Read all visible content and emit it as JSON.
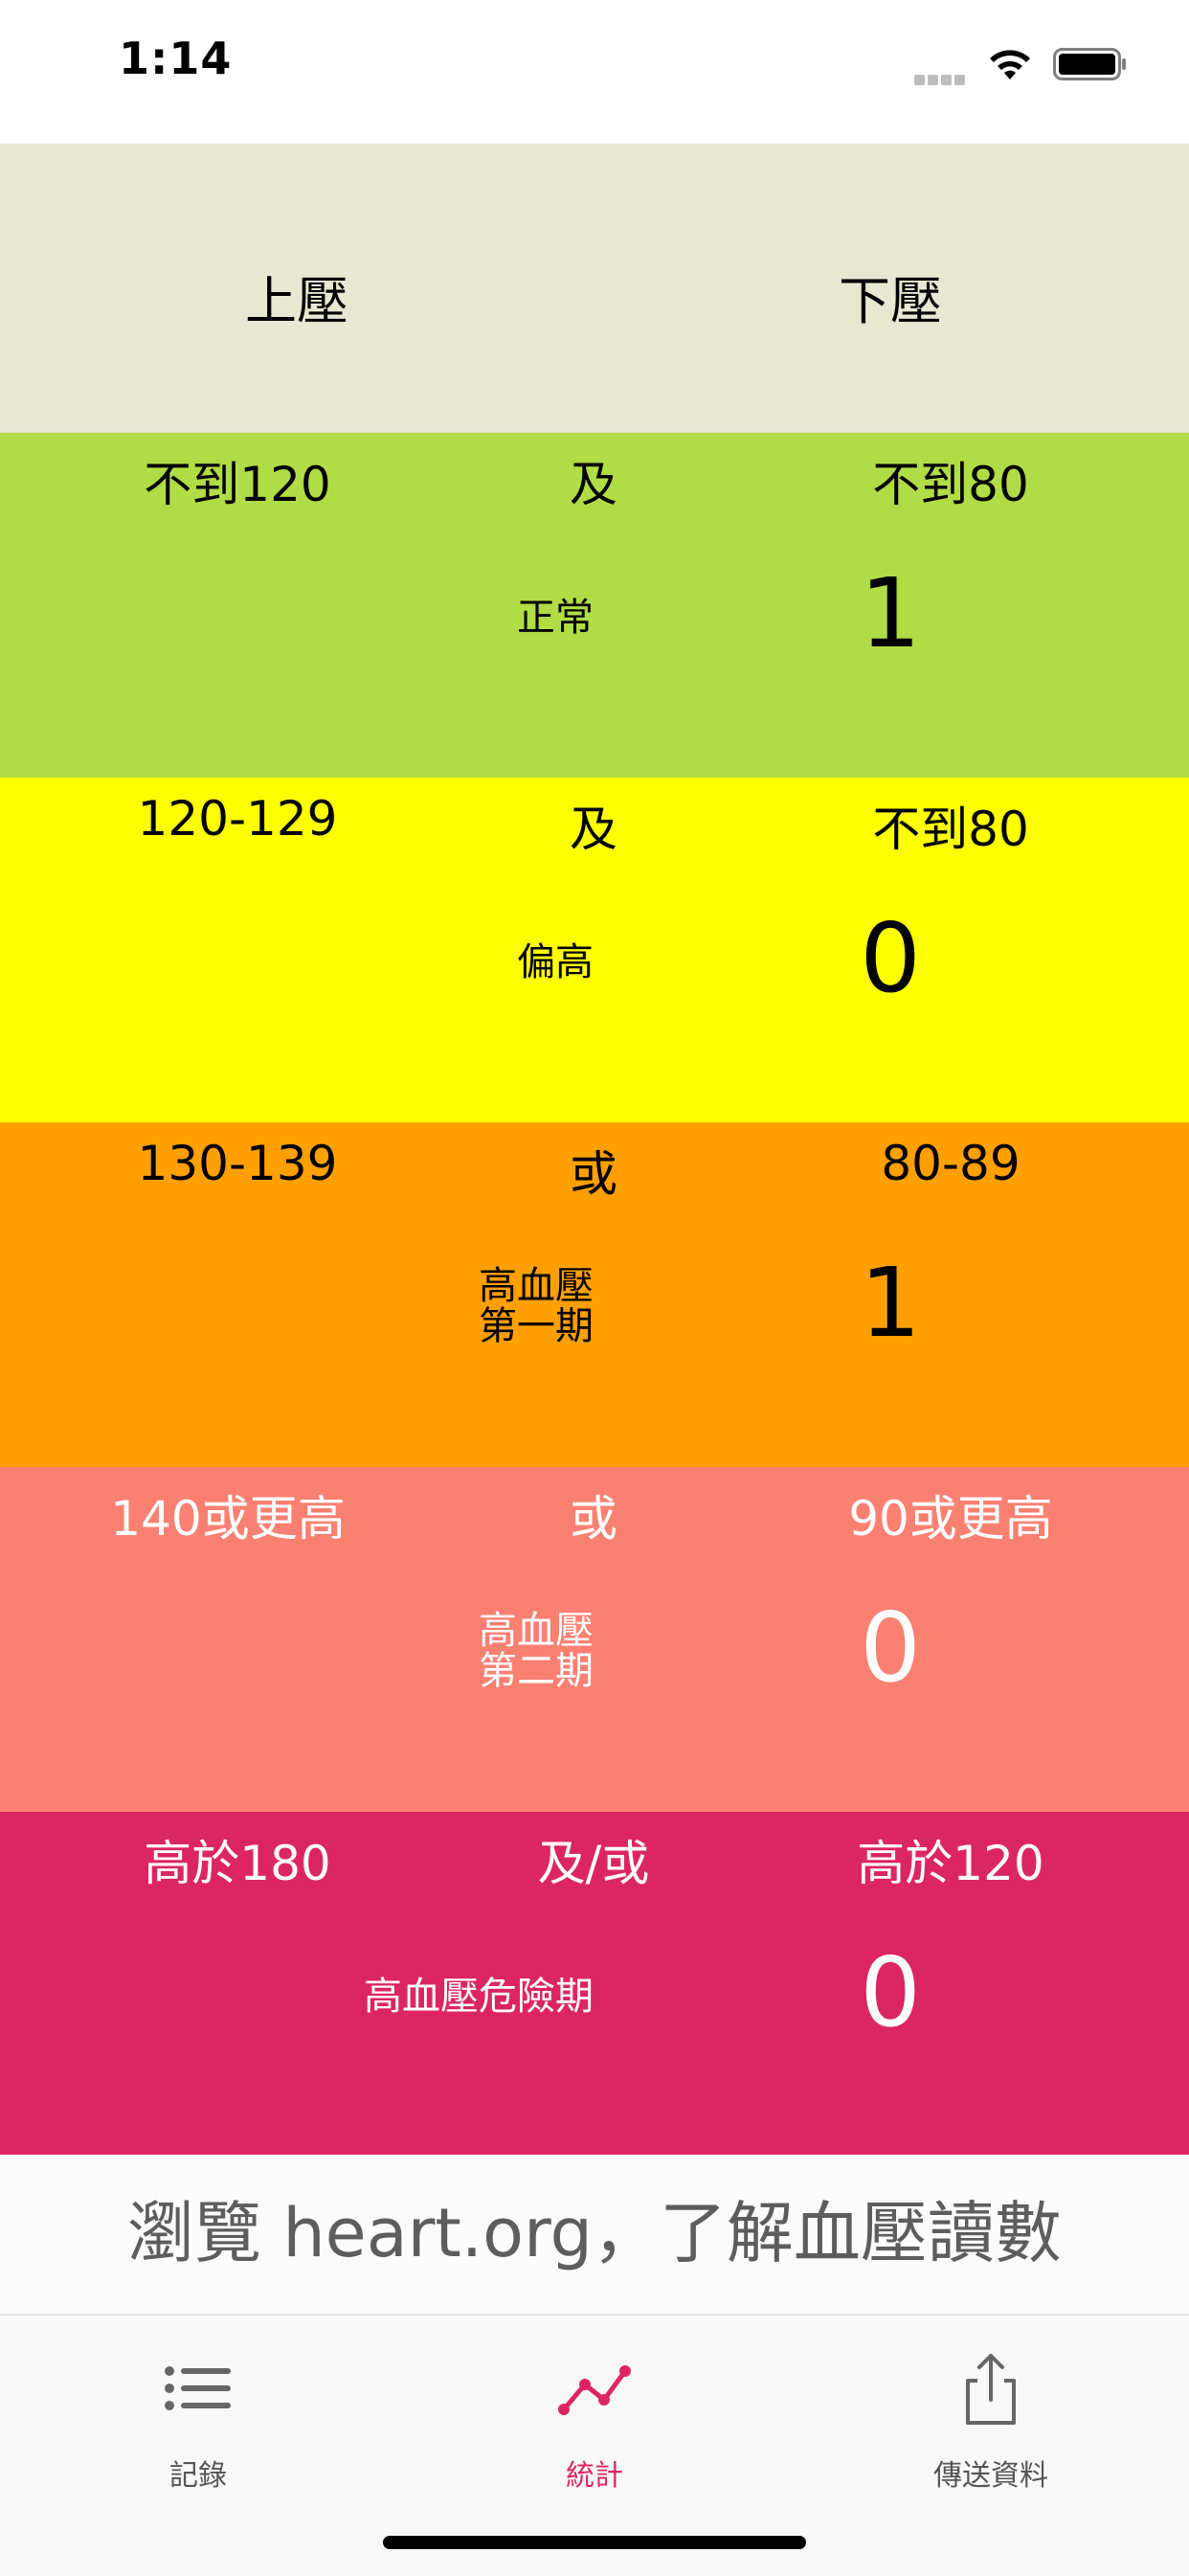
{
  "status_bar": {
    "time": "1:14"
  },
  "header": {
    "systolic_label": "上壓",
    "diastolic_label": "下壓",
    "background": "#e8e8d2"
  },
  "rows": [
    {
      "systolic": "不到120",
      "conjunction": "及",
      "diastolic": "不到80",
      "name_lines": [
        "正常"
      ],
      "count": "1",
      "background": "#b0dd46",
      "text_color": "#000000"
    },
    {
      "systolic": "120-129",
      "conjunction": "及",
      "diastolic": "不到80",
      "name_lines": [
        "偏高"
      ],
      "count": "0",
      "background": "#ffff00",
      "text_color": "#000000"
    },
    {
      "systolic": "130-139",
      "conjunction": "或",
      "diastolic": "80-89",
      "name_lines": [
        "高血壓",
        "第一期"
      ],
      "count": "1",
      "background": "#ffa000",
      "text_color": "#000000"
    },
    {
      "systolic": "140或更高",
      "conjunction": "或",
      "diastolic": "90或更高",
      "name_lines": [
        "高血壓",
        "第二期"
      ],
      "count": "0",
      "background": "#fa8072",
      "text_color": "#ffffff"
    },
    {
      "systolic": "高於180",
      "conjunction": "及/或",
      "diastolic": "高於120",
      "name_lines": [
        "高血壓危險期"
      ],
      "count": "0",
      "background": "#dc2563",
      "text_color": "#ffffff"
    }
  ],
  "link": {
    "text": "瀏覽 heart.org，了解血壓讀數"
  },
  "tabs": [
    {
      "label": "記錄",
      "icon": "list-icon",
      "active": false
    },
    {
      "label": "統計",
      "icon": "chart-line-icon",
      "active": true
    },
    {
      "label": "傳送資料",
      "icon": "share-icon",
      "active": false
    }
  ],
  "colors": {
    "accent": "#dd2566"
  }
}
